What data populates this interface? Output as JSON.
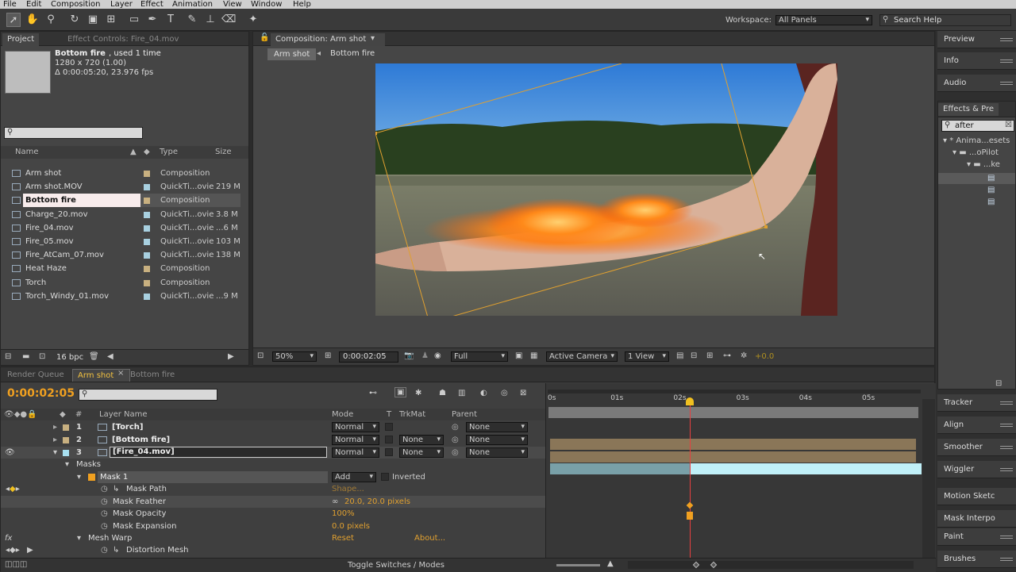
{
  "menu": [
    "File",
    "Edit",
    "Composition",
    "Layer",
    "Effect",
    "Animation",
    "View",
    "Window",
    "Help"
  ],
  "workspace": {
    "label": "Workspace:",
    "value": "All Panels",
    "search_placeholder": "Search Help"
  },
  "project_panel": {
    "tabs": [
      "Project",
      "Effect Controls: Fire_04.mov"
    ],
    "preview_name": "Bottom fire",
    "preview_used": ", used 1 time",
    "preview_dims": "1280 x 720 (1.00)",
    "preview_duration": "Δ 0:00:05:20, 23.976 fps",
    "columns": {
      "name": "Name",
      "type": "Type",
      "size": "Size"
    },
    "items": [
      {
        "name": "Arm shot",
        "type": "Composition",
        "size": "",
        "kind": "comp",
        "label_color": "#c8b080"
      },
      {
        "name": "Arm shot.MOV",
        "type": "QuickTi...ovie",
        "size": "219 M",
        "kind": "movie",
        "label_color": "#a8d0e0"
      },
      {
        "name": "Bottom fire",
        "type": "Composition",
        "size": "",
        "kind": "comp",
        "label_color": "#c8b080",
        "selected": true
      },
      {
        "name": "Charge_20.mov",
        "type": "QuickTi...ovie",
        "size": "3.8 M",
        "kind": "movie",
        "label_color": "#a8d0e0"
      },
      {
        "name": "Fire_04.mov",
        "type": "QuickTi...ovie",
        "size": "...6 M",
        "kind": "movie",
        "label_color": "#a8d0e0"
      },
      {
        "name": "Fire_05.mov",
        "type": "QuickTi...ovie",
        "size": "103 M",
        "kind": "movie",
        "label_color": "#a8d0e0"
      },
      {
        "name": "Fire_AtCam_07.mov",
        "type": "QuickTi...ovie",
        "size": "138 M",
        "kind": "movie",
        "label_color": "#a8d0e0"
      },
      {
        "name": "Heat Haze",
        "type": "Composition",
        "size": "",
        "kind": "comp",
        "label_color": "#c8b080"
      },
      {
        "name": "Torch",
        "type": "Composition",
        "size": "",
        "kind": "comp",
        "label_color": "#c8b080"
      },
      {
        "name": "Torch_Windy_01.mov",
        "type": "QuickTi...ovie",
        "size": "...9 M",
        "kind": "movie",
        "label_color": "#a8d0e0"
      }
    ],
    "bpc": "16 bpc"
  },
  "comp_panel": {
    "tab": "Composition: Arm shot",
    "breadcrumbs": [
      "Arm shot",
      "Bottom fire"
    ],
    "zoom": "50%",
    "timecode": "0:00:02:05",
    "resolution": "Full",
    "camera": "Active Camera",
    "view": "1 View",
    "exposure": "+0.0"
  },
  "right_panels": [
    "Preview",
    "Info",
    "Audio",
    "Effects & Pre",
    "Tracker",
    "Align",
    "Smoother",
    "Wiggler",
    "Motion Sketc",
    "Mask Interpo",
    "Paint",
    "Brushes"
  ],
  "effects": {
    "search": "after",
    "tree": [
      "* Anima...esets",
      "...oPilot",
      "...ke"
    ]
  },
  "timeline": {
    "tabs": [
      "Render Queue",
      "Arm shot",
      "Bottom fire"
    ],
    "timecode": "0:00:02:05",
    "headers": {
      "layer_name": "Layer Name",
      "mode": "Mode",
      "t": "T",
      "trkmat": "TrkMat",
      "parent": "Parent"
    },
    "ruler": [
      "0s",
      "01s",
      "02s",
      "03s",
      "04s",
      "05s"
    ],
    "layers": [
      {
        "num": "1",
        "name": "[Torch]",
        "mode": "Normal",
        "trkmat": "",
        "parent": "None"
      },
      {
        "num": "2",
        "name": "[Bottom fire]",
        "mode": "Normal",
        "trkmat": "None",
        "parent": "None"
      },
      {
        "num": "3",
        "name": "[Fire_04.mov]",
        "mode": "Normal",
        "trkmat": "None",
        "parent": "None"
      }
    ],
    "masks_label": "Masks",
    "mask1": {
      "name": "Mask 1",
      "mode": "Add",
      "inverted": "Inverted"
    },
    "props": [
      {
        "name": "Mask Path",
        "value": "Shape..."
      },
      {
        "name": "Mask Feather",
        "value": "20.0, 20.0 pixels"
      },
      {
        "name": "Mask Opacity",
        "value": "100%"
      },
      {
        "name": "Mask Expansion",
        "value": "0.0 pixels"
      }
    ],
    "mesh_warp": {
      "name": "Mesh Warp",
      "reset": "Reset",
      "about": "About..."
    },
    "distortion": "Distortion Mesh",
    "toggle": "Toggle Switches / Modes"
  }
}
